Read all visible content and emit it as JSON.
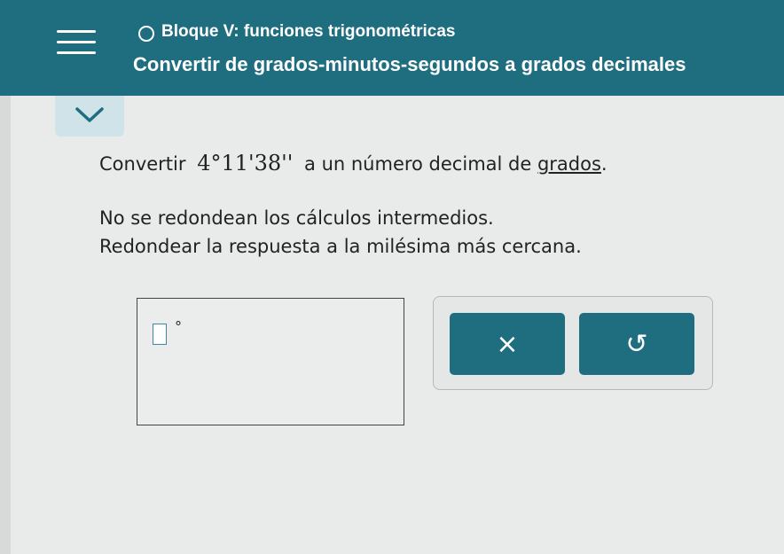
{
  "header": {
    "topic_title": "Bloque V: funciones trigonométricas",
    "lesson_title": "Convertir de grados-minutos-segundos a grados decimales",
    "background_color": "#1f6e80"
  },
  "icons": {
    "menu": "hamburger-menu-icon",
    "status": "circle-icon",
    "collapse": "chevron-down-icon",
    "clear": "close-icon",
    "undo": "undo-icon"
  },
  "question": {
    "prefix": "Convertir",
    "angle_dms": "4°11'38''",
    "suffix_before_link": "a un número decimal de",
    "link_text": "grados",
    "suffix_after_link": "."
  },
  "instructions": {
    "line1": "No se redondean los cálculos intermedios.",
    "line2": "Redondear la respuesta a la milésima más cercana."
  },
  "answer": {
    "value": "",
    "unit_symbol": "°"
  },
  "buttons": {
    "clear_label": "×",
    "undo_label": "↺"
  }
}
